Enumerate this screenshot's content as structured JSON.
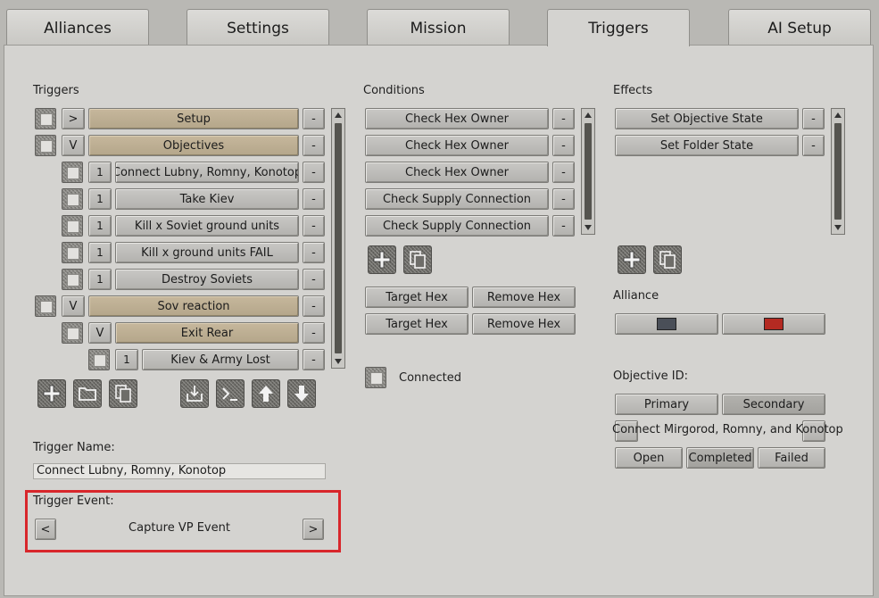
{
  "tabs": [
    {
      "label": "Alliances",
      "active": false
    },
    {
      "label": "Settings",
      "active": false
    },
    {
      "label": "Mission",
      "active": false
    },
    {
      "label": "Triggers",
      "active": true
    },
    {
      "label": "AI Setup",
      "active": false
    }
  ],
  "triggers": {
    "heading": "Triggers",
    "items": [
      {
        "expander": ">",
        "label": "Setup",
        "level": 0,
        "folder": true
      },
      {
        "expander": "V",
        "label": "Objectives",
        "level": 0,
        "folder": true
      },
      {
        "expander": "1",
        "label": "Connect Lubny, Romny, Konotop",
        "level": 1,
        "folder": false
      },
      {
        "expander": "1",
        "label": "Take Kiev",
        "level": 1,
        "folder": false
      },
      {
        "expander": "1",
        "label": "Kill x Soviet ground units",
        "level": 1,
        "folder": false
      },
      {
        "expander": "1",
        "label": "Kill x ground units FAIL",
        "level": 1,
        "folder": false
      },
      {
        "expander": "1",
        "label": "Destroy Soviets",
        "level": 1,
        "folder": false
      },
      {
        "expander": "V",
        "label": "Sov reaction",
        "level": 0,
        "folder": true
      },
      {
        "expander": "V",
        "label": "Exit Rear",
        "level": 1,
        "folder": true
      },
      {
        "expander": "1",
        "label": "Kiev & Army Lost",
        "level": 2,
        "folder": false
      }
    ],
    "remove_label": "-",
    "name_label": "Trigger Name:",
    "name_value": "Connect Lubny, Romny, Konotop",
    "event_label": "Trigger Event:",
    "event_value": "Capture VP Event",
    "event_prev": "<",
    "event_next": ">"
  },
  "conditions": {
    "heading": "Conditions",
    "items": [
      "Check Hex Owner",
      "Check Hex Owner",
      "Check Hex Owner",
      "Check Supply Connection",
      "Check Supply Connection"
    ],
    "remove_label": "-",
    "target_hex_label": "Target Hex",
    "remove_hex_label": "Remove Hex",
    "connected_label": "Connected"
  },
  "effects": {
    "heading": "Effects",
    "items": [
      "Set Objective State",
      "Set Folder State"
    ],
    "remove_label": "-",
    "alliance_label": "Alliance",
    "alliance_colors": [
      "#4a4f58",
      "#b42a22"
    ],
    "objective_id_label": "Objective ID:",
    "primary_label": "Primary",
    "secondary_label": "Secondary",
    "objective_name": "Connect Mirgorod, Romny, and Konotop",
    "open_label": "Open",
    "completed_label": "Completed",
    "failed_label": "Failed"
  },
  "icons": {
    "add": "plus-icon",
    "new_folder": "folder-icon",
    "copy": "copy-icon",
    "import": "import-icon",
    "script": "console-icon",
    "move_up": "arrow-up-icon",
    "move_down": "arrow-down-icon"
  },
  "colors": {
    "highlight": "#d8262b",
    "folder_button": "#c6b79c"
  }
}
